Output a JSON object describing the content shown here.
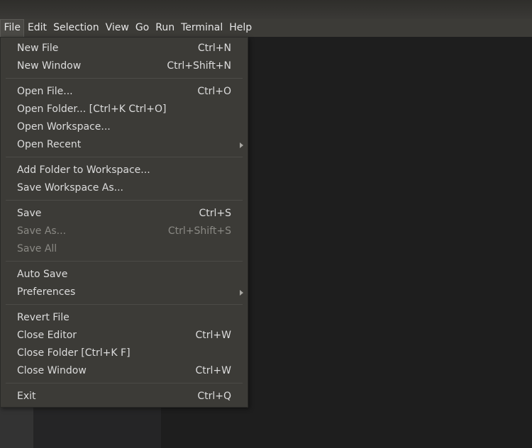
{
  "menubar": {
    "items": [
      {
        "label": "File"
      },
      {
        "label": "Edit"
      },
      {
        "label": "Selection"
      },
      {
        "label": "View"
      },
      {
        "label": "Go"
      },
      {
        "label": "Run"
      },
      {
        "label": "Terminal"
      },
      {
        "label": "Help"
      }
    ]
  },
  "file_menu": {
    "new_file": {
      "label": "New File",
      "shortcut": "Ctrl+N"
    },
    "new_window": {
      "label": "New Window",
      "shortcut": "Ctrl+Shift+N"
    },
    "open_file": {
      "label": "Open File...",
      "shortcut": "Ctrl+O"
    },
    "open_folder": {
      "label": "Open Folder... [Ctrl+K Ctrl+O]"
    },
    "open_workspace": {
      "label": "Open Workspace..."
    },
    "open_recent": {
      "label": "Open Recent",
      "submenu_icon": "chevron-right-icon"
    },
    "add_folder": {
      "label": "Add Folder to Workspace..."
    },
    "save_workspace_as": {
      "label": "Save Workspace As..."
    },
    "save": {
      "label": "Save",
      "shortcut": "Ctrl+S"
    },
    "save_as": {
      "label": "Save As...",
      "shortcut": "Ctrl+Shift+S",
      "disabled": true
    },
    "save_all": {
      "label": "Save All",
      "disabled": true
    },
    "auto_save": {
      "label": "Auto Save"
    },
    "preferences": {
      "label": "Preferences",
      "submenu_icon": "chevron-right-icon"
    },
    "revert_file": {
      "label": "Revert File"
    },
    "close_editor": {
      "label": "Close Editor",
      "shortcut": "Ctrl+W"
    },
    "close_folder": {
      "label": "Close Folder [Ctrl+K F]"
    },
    "close_window": {
      "label": "Close Window",
      "shortcut": "Ctrl+W"
    },
    "exit": {
      "label": "Exit",
      "shortcut": "Ctrl+Q"
    }
  },
  "colors": {
    "menubar_bg": "#3c3b37",
    "menu_text": "#dcdcdc",
    "disabled_text": "#8a8984",
    "editor_bg": "#1e1e1e"
  }
}
